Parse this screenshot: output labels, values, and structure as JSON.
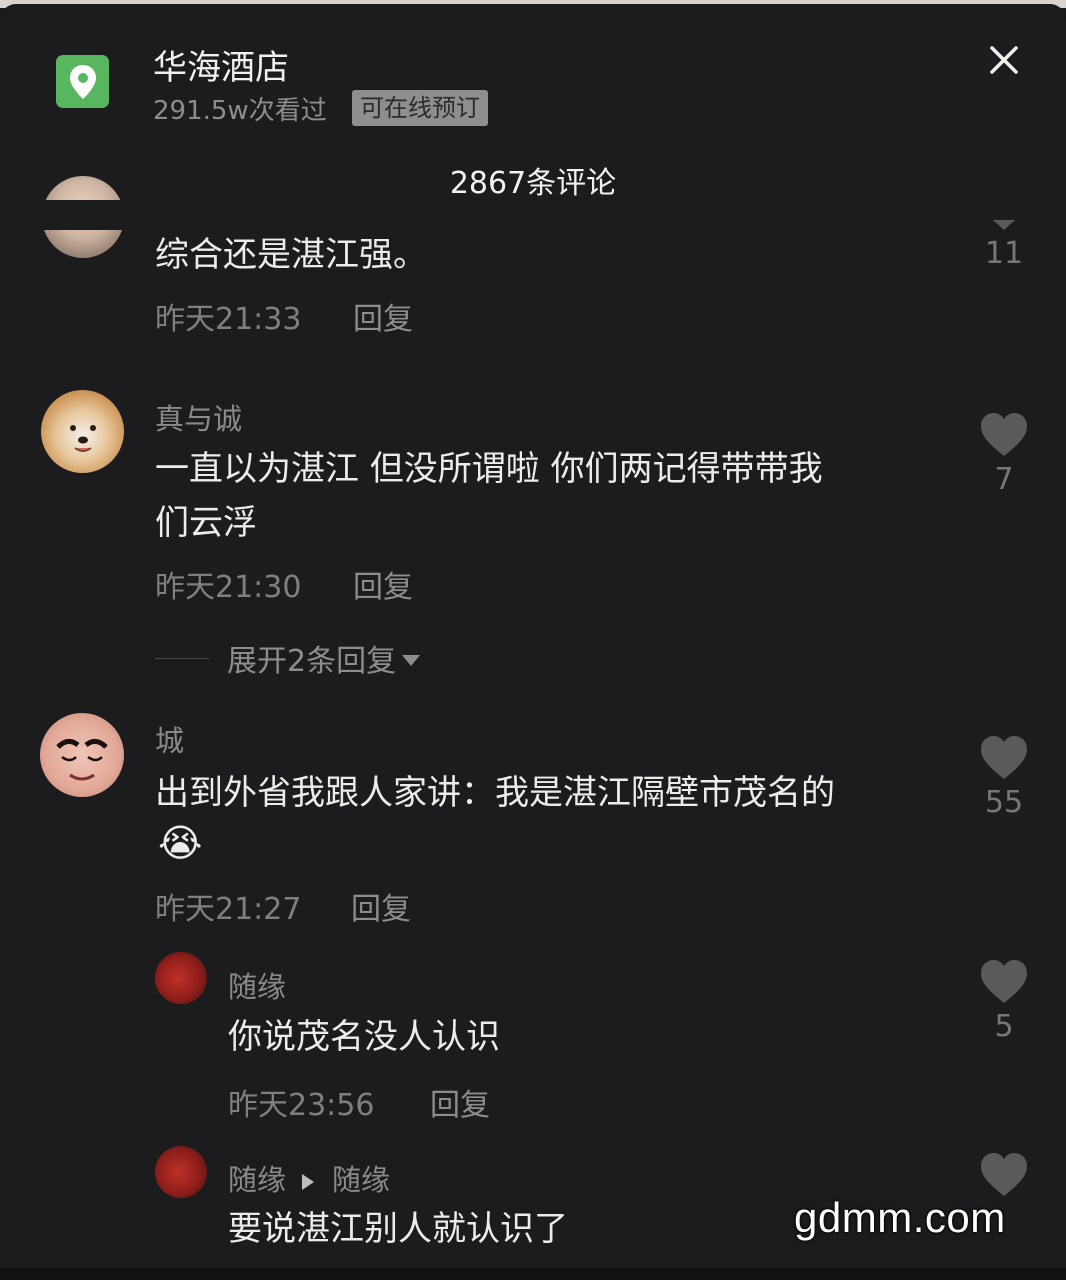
{
  "header": {
    "hotel_name": "华海酒店",
    "views": "291.5w次看过",
    "booking_tag": "可在线预订",
    "comment_count": "2867条评论"
  },
  "comments": [
    {
      "user": "",
      "text": "综合还是湛江强。",
      "time": "昨天21:33",
      "reply": "回复",
      "likes": "11"
    },
    {
      "user": "真与诚",
      "text_line1": "一直以为湛江 但没所谓啦 你们两记得带带我",
      "text_line2": "们云浮",
      "time": "昨天21:30",
      "reply": "回复",
      "likes": "7",
      "expand": "展开2条回复"
    },
    {
      "user": "城",
      "text_line1": "出到外省我跟人家讲：我是湛江隔壁市茂名的",
      "emoji": "😭",
      "time": "昨天21:27",
      "reply": "回复",
      "likes": "55"
    }
  ],
  "replies": [
    {
      "user": "随缘",
      "text": "你说茂名没人认识",
      "time": "昨天23:56",
      "reply": "回复",
      "likes": "5"
    },
    {
      "user": "随缘",
      "reply_to": "随缘",
      "text": "要说湛江别人就认识了"
    }
  ],
  "watermark": "gdmm.com",
  "icons": [
    "location-pin-icon",
    "close-icon",
    "heart-icon",
    "caret-down-icon"
  ],
  "colors": {
    "background": "#1c1c1e",
    "badge_green": "#58b65e",
    "muted_text": "#8d8d90"
  }
}
